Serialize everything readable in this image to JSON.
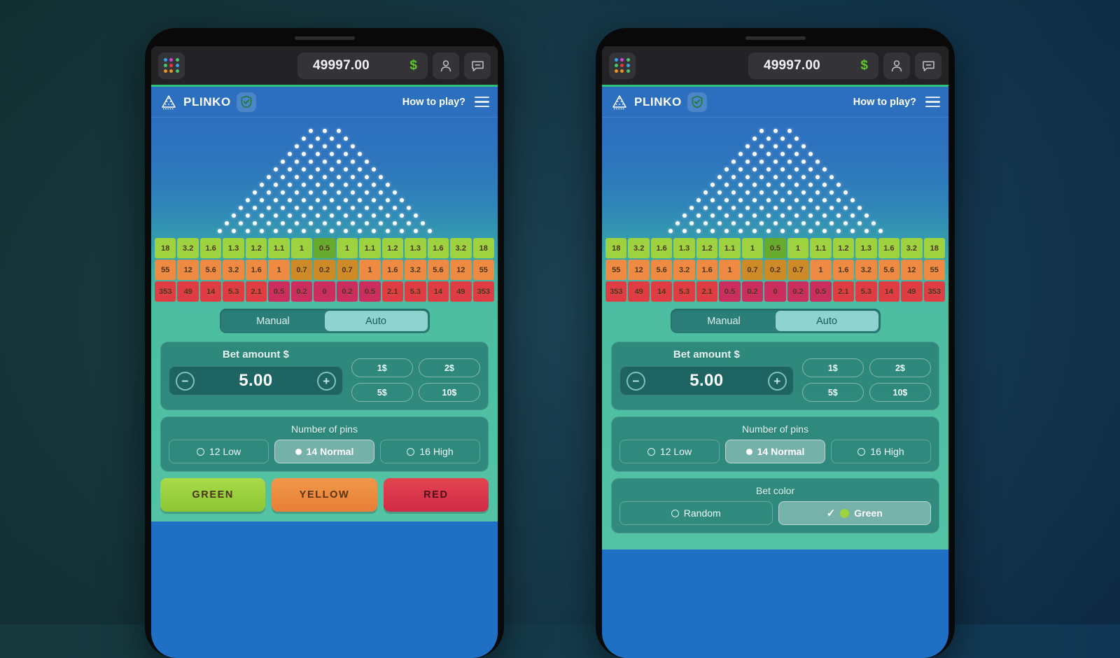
{
  "background": {
    "left_color": "#15393c",
    "right_color": "#103352"
  },
  "topbar": {
    "apps_icon": "apps-grid-icon",
    "apps_dot_colors": [
      "#3aa0e8",
      "#d044d0",
      "#49c46a",
      "#49c46a",
      "#e23b3b",
      "#3aa0e8",
      "#e8921f",
      "#e8921f",
      "#49c46a"
    ],
    "balance": "49997.00",
    "currency": "$",
    "currency_color": "#62c432",
    "profile_icon": "person-icon",
    "chat_icon": "chat-bubble-icon",
    "accent_line_color": "#2fbf7f"
  },
  "gamebar": {
    "logo_icon": "plinko-triangle-icon",
    "title": "PLINKO",
    "verified_icon": "shield-check-icon",
    "how_to_play": "How to play?",
    "menu_icon": "hamburger-menu-icon"
  },
  "board": {
    "pin_rows": [
      3,
      4,
      5,
      6,
      7,
      8,
      9,
      10,
      11,
      12,
      13,
      14,
      15,
      16
    ],
    "rows": [
      {
        "color": "green",
        "color_hex": "#9ed23f",
        "values": [
          "18",
          "3.2",
          "1.6",
          "1.3",
          "1.2",
          "1.1",
          "1",
          "0.5",
          "1",
          "1.1",
          "1.2",
          "1.3",
          "1.6",
          "3.2",
          "18"
        ],
        "dim_index": [
          7
        ]
      },
      {
        "color": "yellow",
        "color_hex": "#ef8a43",
        "values": [
          "55",
          "12",
          "5.6",
          "3.2",
          "1.6",
          "1",
          "0.7",
          "0.2",
          "0.7",
          "1",
          "1.6",
          "3.2",
          "5.6",
          "12",
          "55"
        ],
        "dim_index": [
          6,
          7,
          8
        ]
      },
      {
        "color": "red",
        "color_hex": "#e03c43",
        "values": [
          "353",
          "49",
          "14",
          "5.3",
          "2.1",
          "0.5",
          "0.2",
          "0",
          "0.2",
          "0.5",
          "2.1",
          "5.3",
          "14",
          "49",
          "353"
        ],
        "dim_index": [
          5,
          6,
          7,
          8,
          9
        ]
      }
    ]
  },
  "controls": {
    "mode_tabs": [
      {
        "label": "Manual",
        "active": false
      },
      {
        "label": "Auto",
        "active": true
      }
    ],
    "bet": {
      "title": "Bet amount $",
      "value": "5.00",
      "decrease_label": "−",
      "increase_label": "+",
      "quick_chips": [
        "1$",
        "2$",
        "5$",
        "10$"
      ]
    },
    "pins": {
      "title": "Number of pins",
      "options": [
        {
          "label": "12 Low",
          "selected": false
        },
        {
          "label": "14 Normal",
          "selected": true
        },
        {
          "label": "16 High",
          "selected": false
        }
      ]
    },
    "color_buttons": [
      {
        "label": "GREEN",
        "color": "#9ed23f"
      },
      {
        "label": "YELLOW",
        "color": "#ef8a43"
      },
      {
        "label": "RED",
        "color": "#e03c43"
      }
    ],
    "bet_color": {
      "title": "Bet color",
      "options": [
        {
          "label": "Random",
          "selected": false,
          "swatch": null
        },
        {
          "label": "Green",
          "selected": true,
          "swatch": "#9ed23f"
        }
      ]
    }
  }
}
